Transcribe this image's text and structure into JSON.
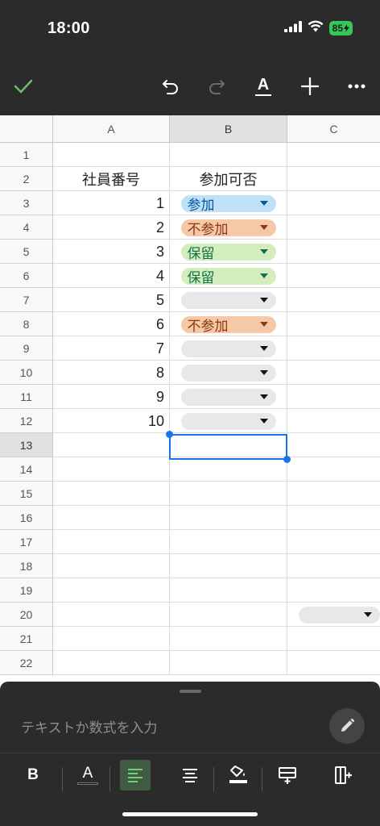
{
  "status": {
    "time": "18:00",
    "battery": "85"
  },
  "toolbar": {
    "confirm_icon": "checkmark-icon",
    "undo_icon": "undo-icon",
    "redo_icon": "redo-icon",
    "text_format_icon": "text-format-icon",
    "insert_icon": "plus-icon",
    "more_icon": "more-icon",
    "text_format_glyph": "A"
  },
  "sheet": {
    "columns": [
      "A",
      "B",
      "C"
    ],
    "selected_column": "B",
    "row_numbers": [
      "1",
      "2",
      "3",
      "4",
      "5",
      "6",
      "7",
      "8",
      "9",
      "10",
      "11",
      "12",
      "13",
      "14",
      "15",
      "16",
      "17",
      "18",
      "19",
      "20",
      "21",
      "22"
    ],
    "selected_row": "13",
    "header_row": {
      "a": "社員番号",
      "b": "参加可否"
    },
    "rows": [
      {
        "num": "1",
        "status": "参加",
        "chip": "blue"
      },
      {
        "num": "2",
        "status": "不参加",
        "chip": "orange"
      },
      {
        "num": "3",
        "status": "保留",
        "chip": "green"
      },
      {
        "num": "4",
        "status": "保留",
        "chip": "green"
      },
      {
        "num": "5",
        "status": "",
        "chip": "empty"
      },
      {
        "num": "6",
        "status": "不参加",
        "chip": "orange"
      },
      {
        "num": "7",
        "status": "",
        "chip": "empty"
      },
      {
        "num": "8",
        "status": "",
        "chip": "empty"
      },
      {
        "num": "9",
        "status": "",
        "chip": "empty"
      },
      {
        "num": "10",
        "status": "",
        "chip": "empty"
      }
    ],
    "colors": {
      "accent": "#1a73e8",
      "blue_chip": "#bfe1f6",
      "orange_chip": "#f7c8a8",
      "green_chip": "#d4edbc",
      "empty_chip": "#e8e8ea"
    }
  },
  "editor": {
    "placeholder": "テキストか数式を入力",
    "edit_icon": "pencil-icon",
    "format_buttons": [
      "bold-icon",
      "text-color-icon",
      "align-left-icon",
      "align-center-icon",
      "fill-color-icon",
      "insert-row-icon",
      "insert-column-icon"
    ],
    "bold_label": "B",
    "text_color_glyph": "A"
  }
}
